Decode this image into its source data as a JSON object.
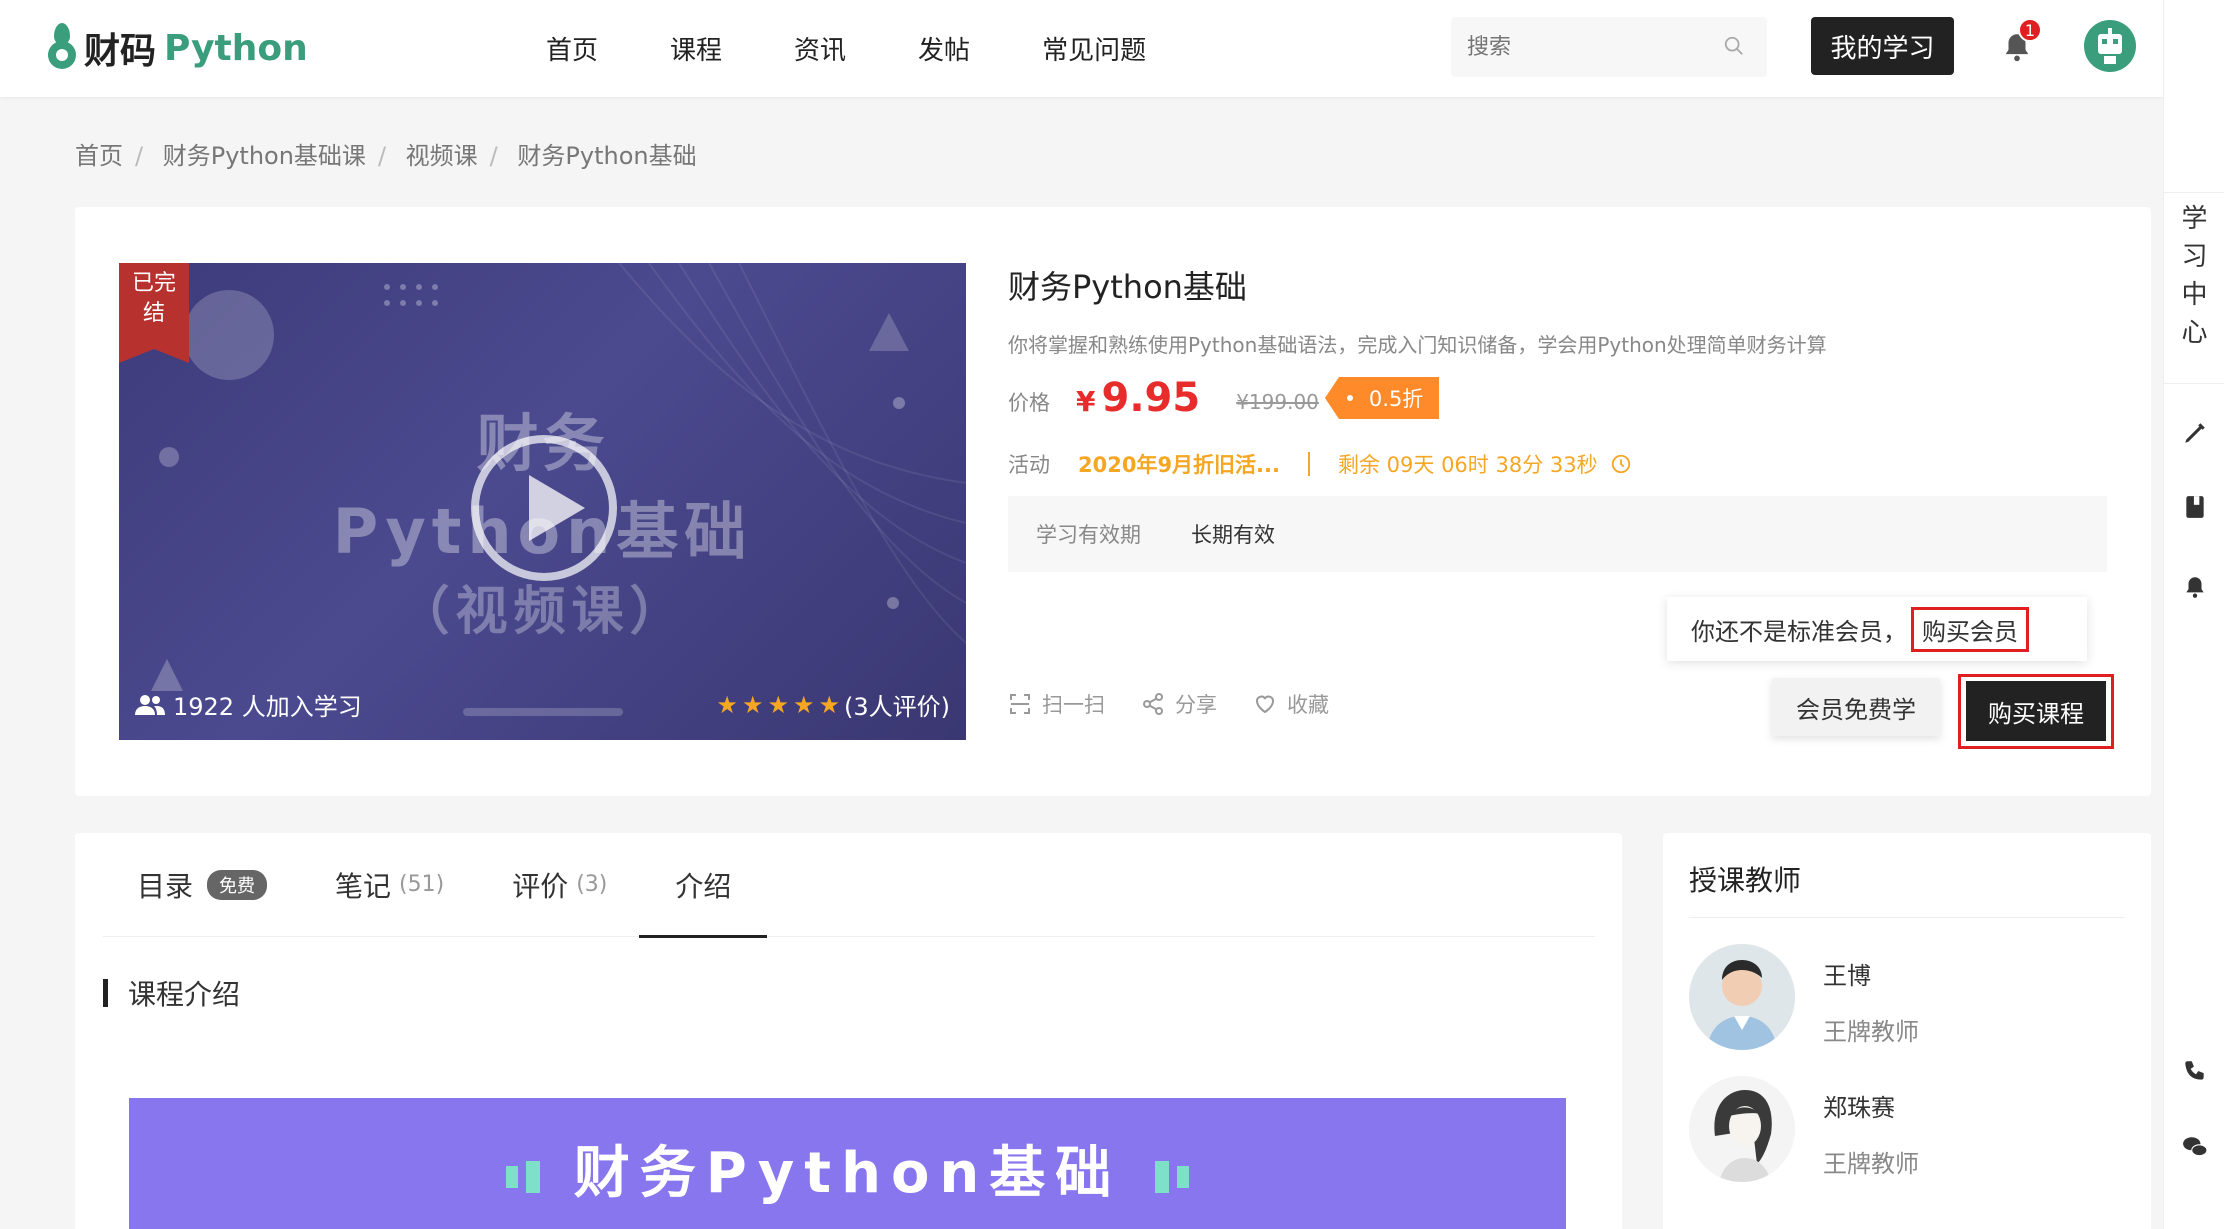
{
  "header": {
    "logo_cn": "财码",
    "logo_en": "Python",
    "nav": [
      "首页",
      "课程",
      "资讯",
      "发帖",
      "常见问题"
    ],
    "search_placeholder": "搜索",
    "my_study": "我的学习",
    "notifications": "1"
  },
  "rail": {
    "label": "学习中心",
    "icons": [
      "pencil-icon",
      "notebook-icon",
      "bell-icon",
      "phone-icon",
      "wechat-icon"
    ]
  },
  "breadcrumb": [
    "首页",
    "财务Python基础课",
    "视频课",
    "财务Python基础"
  ],
  "course": {
    "cover": {
      "ribbon": "已完结",
      "title_line1": "财务",
      "title_line2": "Python基础",
      "title_line3": "（视频课）",
      "learners": "1922 人加入学习",
      "rating_stars": 5,
      "rating_text": "(3人评价)"
    },
    "title": "财务Python基础",
    "description": "你将掌握和熟练使用Python基础语法，完成入门知识储备，学会用Python处理简单财务计算",
    "price_label": "价格",
    "currency": "¥",
    "price": "9.95",
    "original_price": "¥199.00",
    "discount": "0.5折",
    "activity_label": "活动",
    "activity_name": "2020年9月折旧活...",
    "countdown": "剩余 09天 06时 38分 33秒",
    "validity_label": "学习有效期",
    "validity_value": "长期有效",
    "member_tip": "你还不是标准会员，",
    "member_link": "购买会员",
    "actions": {
      "scan": "扫一扫",
      "share": "分享",
      "favorite": "收藏"
    },
    "member_free_btn": "会员免费学",
    "buy_btn": "购买课程"
  },
  "tabs": [
    {
      "label": "目录",
      "badge": "免费",
      "count": ""
    },
    {
      "label": "笔记",
      "badge": "",
      "count": "(51)"
    },
    {
      "label": "评价",
      "badge": "",
      "count": "(3)"
    },
    {
      "label": "介绍",
      "badge": "",
      "count": ""
    }
  ],
  "intro": {
    "section_title": "课程介绍",
    "banner_text": "财务Python基础"
  },
  "teachers": {
    "title": "授课教师",
    "list": [
      {
        "name": "王博",
        "role": "王牌教师"
      },
      {
        "name": "郑珠赛",
        "role": "王牌教师"
      }
    ]
  }
}
